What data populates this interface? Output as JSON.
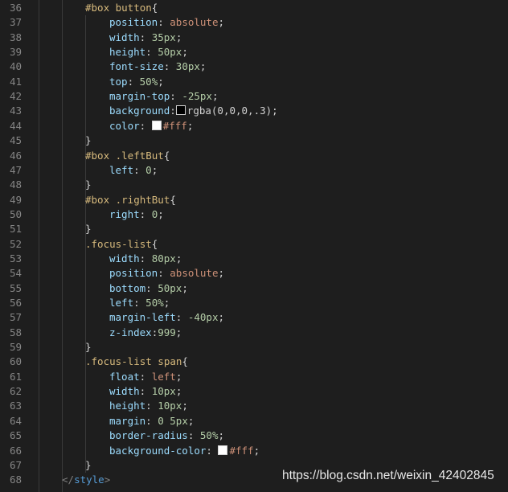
{
  "editor": {
    "lines": [
      {
        "n": "36",
        "indent": 2,
        "tokens": [
          {
            "t": "#box button",
            "c": "sel"
          },
          {
            "t": "{",
            "c": "punc"
          }
        ]
      },
      {
        "n": "37",
        "indent": 3,
        "tokens": [
          {
            "t": "position",
            "c": "prop"
          },
          {
            "t": ": ",
            "c": "punc"
          },
          {
            "t": "absolute",
            "c": "val"
          },
          {
            "t": ";",
            "c": "punc"
          }
        ]
      },
      {
        "n": "38",
        "indent": 3,
        "tokens": [
          {
            "t": "width",
            "c": "prop"
          },
          {
            "t": ": ",
            "c": "punc"
          },
          {
            "t": "35px",
            "c": "num"
          },
          {
            "t": ";",
            "c": "punc"
          }
        ]
      },
      {
        "n": "39",
        "indent": 3,
        "tokens": [
          {
            "t": "height",
            "c": "prop"
          },
          {
            "t": ": ",
            "c": "punc"
          },
          {
            "t": "50px",
            "c": "num"
          },
          {
            "t": ";",
            "c": "punc"
          }
        ]
      },
      {
        "n": "40",
        "indent": 3,
        "tokens": [
          {
            "t": "font-size",
            "c": "prop"
          },
          {
            "t": ": ",
            "c": "punc"
          },
          {
            "t": "30px",
            "c": "num"
          },
          {
            "t": ";",
            "c": "punc"
          }
        ]
      },
      {
        "n": "41",
        "indent": 3,
        "tokens": [
          {
            "t": "top",
            "c": "prop"
          },
          {
            "t": ": ",
            "c": "punc"
          },
          {
            "t": "50%",
            "c": "num"
          },
          {
            "t": ";",
            "c": "punc"
          }
        ]
      },
      {
        "n": "42",
        "indent": 3,
        "tokens": [
          {
            "t": "margin-top",
            "c": "prop"
          },
          {
            "t": ": ",
            "c": "punc"
          },
          {
            "t": "-25px",
            "c": "num"
          },
          {
            "t": ";",
            "c": "punc"
          }
        ]
      },
      {
        "n": "43",
        "indent": 3,
        "tokens": [
          {
            "t": "background",
            "c": "prop"
          },
          {
            "t": ":",
            "c": "punc"
          },
          {
            "swatch": "rgba(0,0,0,.3)",
            "fill": "#000000"
          },
          {
            "t": "rgba(0,0,0,.3)",
            "c": "punc"
          },
          {
            "t": ";",
            "c": "punc"
          }
        ]
      },
      {
        "n": "44",
        "indent": 3,
        "tokens": [
          {
            "t": "color",
            "c": "prop"
          },
          {
            "t": ": ",
            "c": "punc"
          },
          {
            "swatch": "#fff",
            "fill": "#ffffff"
          },
          {
            "t": "#fff",
            "c": "val"
          },
          {
            "t": ";",
            "c": "punc"
          }
        ]
      },
      {
        "n": "45",
        "indent": 2,
        "tokens": [
          {
            "t": "}",
            "c": "punc"
          }
        ]
      },
      {
        "n": "46",
        "indent": 2,
        "tokens": [
          {
            "t": "#box .leftBut",
            "c": "sel"
          },
          {
            "t": "{",
            "c": "punc"
          }
        ]
      },
      {
        "n": "47",
        "indent": 3,
        "tokens": [
          {
            "t": "left",
            "c": "prop"
          },
          {
            "t": ": ",
            "c": "punc"
          },
          {
            "t": "0",
            "c": "num"
          },
          {
            "t": ";",
            "c": "punc"
          }
        ]
      },
      {
        "n": "48",
        "indent": 2,
        "tokens": [
          {
            "t": "}",
            "c": "punc"
          }
        ]
      },
      {
        "n": "49",
        "indent": 2,
        "tokens": [
          {
            "t": "#box .rightBut",
            "c": "sel"
          },
          {
            "t": "{",
            "c": "punc"
          }
        ]
      },
      {
        "n": "50",
        "indent": 3,
        "tokens": [
          {
            "t": "right",
            "c": "prop"
          },
          {
            "t": ": ",
            "c": "punc"
          },
          {
            "t": "0",
            "c": "num"
          },
          {
            "t": ";",
            "c": "punc"
          }
        ]
      },
      {
        "n": "51",
        "indent": 2,
        "tokens": [
          {
            "t": "}",
            "c": "punc"
          }
        ]
      },
      {
        "n": "52",
        "indent": 2,
        "tokens": [
          {
            "t": ".focus-list",
            "c": "sel"
          },
          {
            "t": "{",
            "c": "punc"
          }
        ]
      },
      {
        "n": "53",
        "indent": 3,
        "tokens": [
          {
            "t": "width",
            "c": "prop"
          },
          {
            "t": ": ",
            "c": "punc"
          },
          {
            "t": "80px",
            "c": "num"
          },
          {
            "t": ";",
            "c": "punc"
          }
        ]
      },
      {
        "n": "54",
        "indent": 3,
        "tokens": [
          {
            "t": "position",
            "c": "prop"
          },
          {
            "t": ": ",
            "c": "punc"
          },
          {
            "t": "absolute",
            "c": "val"
          },
          {
            "t": ";",
            "c": "punc"
          }
        ]
      },
      {
        "n": "55",
        "indent": 3,
        "tokens": [
          {
            "t": "bottom",
            "c": "prop"
          },
          {
            "t": ": ",
            "c": "punc"
          },
          {
            "t": "50px",
            "c": "num"
          },
          {
            "t": ";",
            "c": "punc"
          }
        ]
      },
      {
        "n": "56",
        "indent": 3,
        "tokens": [
          {
            "t": "left",
            "c": "prop"
          },
          {
            "t": ": ",
            "c": "punc"
          },
          {
            "t": "50%",
            "c": "num"
          },
          {
            "t": ";",
            "c": "punc"
          }
        ]
      },
      {
        "n": "57",
        "indent": 3,
        "tokens": [
          {
            "t": "margin-left",
            "c": "prop"
          },
          {
            "t": ": ",
            "c": "punc"
          },
          {
            "t": "-40px",
            "c": "num"
          },
          {
            "t": ";",
            "c": "punc"
          }
        ]
      },
      {
        "n": "58",
        "indent": 3,
        "tokens": [
          {
            "t": "z-index",
            "c": "prop"
          },
          {
            "t": ":",
            "c": "punc"
          },
          {
            "t": "999",
            "c": "num"
          },
          {
            "t": ";",
            "c": "punc"
          }
        ]
      },
      {
        "n": "59",
        "indent": 2,
        "tokens": [
          {
            "t": "}",
            "c": "punc"
          }
        ]
      },
      {
        "n": "60",
        "indent": 2,
        "tokens": [
          {
            "t": ".focus-list span",
            "c": "sel"
          },
          {
            "t": "{",
            "c": "punc"
          }
        ]
      },
      {
        "n": "61",
        "indent": 3,
        "tokens": [
          {
            "t": "float",
            "c": "prop"
          },
          {
            "t": ": ",
            "c": "punc"
          },
          {
            "t": "left",
            "c": "val"
          },
          {
            "t": ";",
            "c": "punc"
          }
        ]
      },
      {
        "n": "62",
        "indent": 3,
        "tokens": [
          {
            "t": "width",
            "c": "prop"
          },
          {
            "t": ": ",
            "c": "punc"
          },
          {
            "t": "10px",
            "c": "num"
          },
          {
            "t": ";",
            "c": "punc"
          }
        ]
      },
      {
        "n": "63",
        "indent": 3,
        "tokens": [
          {
            "t": "height",
            "c": "prop"
          },
          {
            "t": ": ",
            "c": "punc"
          },
          {
            "t": "10px",
            "c": "num"
          },
          {
            "t": ";",
            "c": "punc"
          }
        ]
      },
      {
        "n": "64",
        "indent": 3,
        "tokens": [
          {
            "t": "margin",
            "c": "prop"
          },
          {
            "t": ": ",
            "c": "punc"
          },
          {
            "t": "0 5px",
            "c": "num"
          },
          {
            "t": ";",
            "c": "punc"
          }
        ]
      },
      {
        "n": "65",
        "indent": 3,
        "tokens": [
          {
            "t": "border-radius",
            "c": "prop"
          },
          {
            "t": ": ",
            "c": "punc"
          },
          {
            "t": "50%",
            "c": "num"
          },
          {
            "t": ";",
            "c": "punc"
          }
        ]
      },
      {
        "n": "66",
        "indent": 3,
        "tokens": [
          {
            "t": "background-color",
            "c": "prop"
          },
          {
            "t": ": ",
            "c": "punc"
          },
          {
            "swatch": "#fff",
            "fill": "#ffffff"
          },
          {
            "t": "#fff",
            "c": "val"
          },
          {
            "t": ";",
            "c": "punc"
          }
        ]
      },
      {
        "n": "67",
        "indent": 2,
        "tokens": [
          {
            "t": "}",
            "c": "punc"
          }
        ]
      },
      {
        "n": "68",
        "indent": 1,
        "tokens": [
          {
            "t": "</",
            "c": "tagb"
          },
          {
            "t": "style",
            "c": "tag"
          },
          {
            "t": ">",
            "c": "tagb"
          }
        ]
      }
    ]
  },
  "watermark": "https://blog.csdn.net/weixin_42402845"
}
